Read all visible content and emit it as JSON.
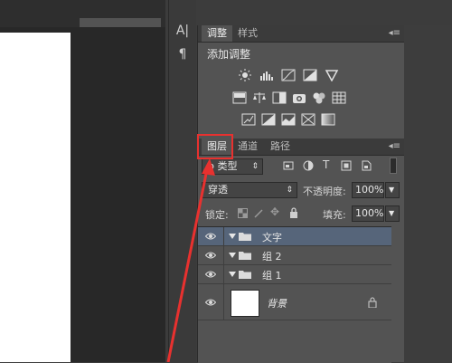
{
  "adjustments_panel": {
    "tabs": [
      "调整",
      "样式"
    ],
    "title": "添加调整",
    "menu_icon": "panel-menu-icon",
    "icons": [
      "brightness-contrast-icon",
      "levels-icon",
      "curves-icon",
      "exposure-icon",
      "vibrance-icon",
      "hue-saturation-icon",
      "color-balance-icon",
      "black-white-icon",
      "photo-filter-icon",
      "channel-mixer-icon",
      "color-lookup-icon",
      "invert-icon",
      "posterize-icon",
      "threshold-icon",
      "selective-color-icon",
      "gradient-map-icon"
    ]
  },
  "layers_panel": {
    "tabs": [
      "图层",
      "通道",
      "路径"
    ],
    "filter_label": "ρ 类型",
    "blend_mode": "穿透",
    "opacity_label": "不透明度:",
    "opacity_value": "100%",
    "lock_label": "锁定:",
    "fill_label": "填充:",
    "fill_value": "100%",
    "layers": [
      {
        "name": "文字",
        "type": "group",
        "selected": true
      },
      {
        "name": "组 2",
        "type": "group",
        "selected": false
      },
      {
        "name": "组 1",
        "type": "group",
        "selected": false
      },
      {
        "name": "背景",
        "type": "background",
        "locked": true
      }
    ]
  },
  "annotation": {
    "highlight_color": "#e8312f",
    "highlighted_tab": "图层"
  }
}
